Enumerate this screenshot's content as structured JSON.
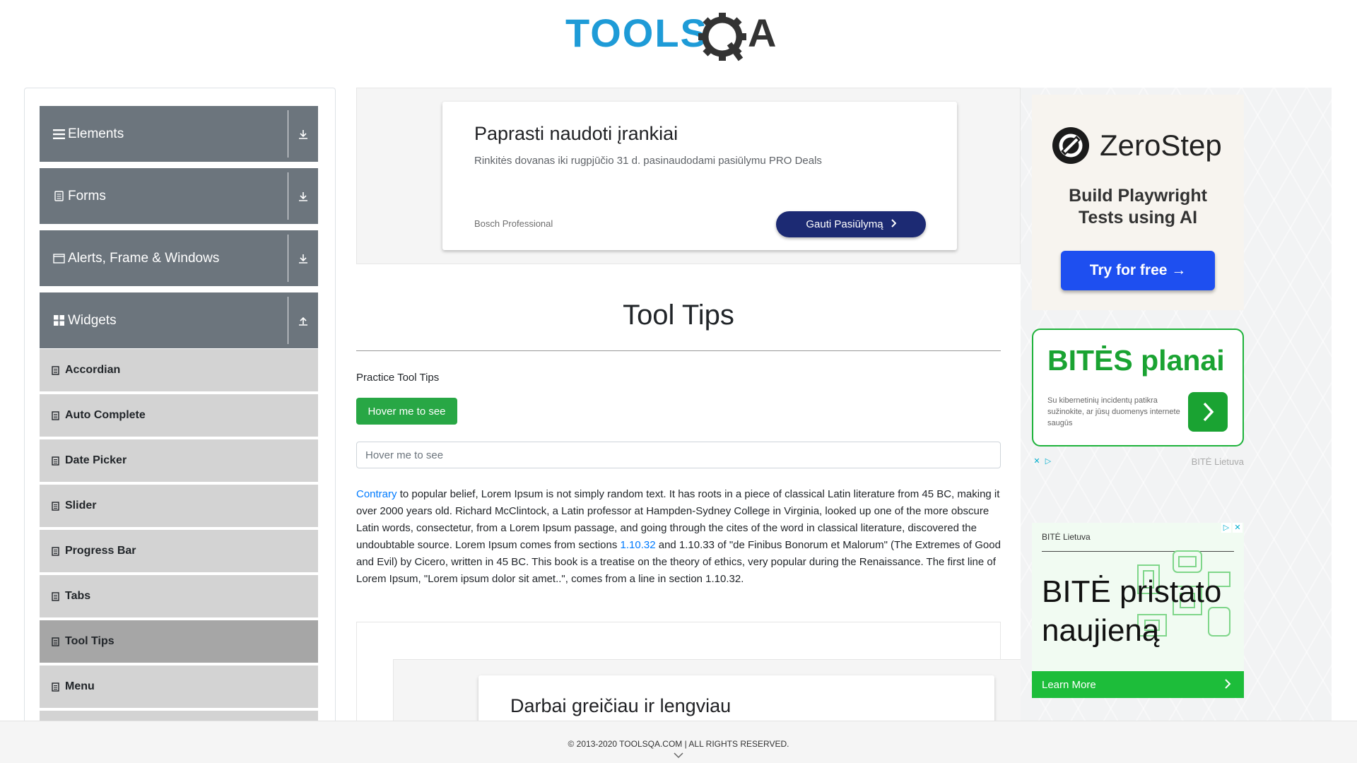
{
  "header": {
    "logo_text_blue": "TOOLS",
    "logo_text_dark": "QA"
  },
  "sidebar": {
    "groups": [
      {
        "title": "Elements",
        "icon": "hamburger-icon",
        "arrow": "download-arrow-icon"
      },
      {
        "title": "Forms",
        "icon": "form-list-icon",
        "arrow": "download-arrow-icon"
      },
      {
        "title": "Alerts, Frame & Windows",
        "icon": "window-icon",
        "arrow": "download-arrow-icon"
      },
      {
        "title": "Widgets",
        "icon": "grid-icon",
        "arrow": "upload-arrow-icon"
      }
    ],
    "items": [
      {
        "label": "Accordian"
      },
      {
        "label": "Auto Complete"
      },
      {
        "label": "Date Picker"
      },
      {
        "label": "Slider"
      },
      {
        "label": "Progress Bar"
      },
      {
        "label": "Tabs"
      },
      {
        "label": "Tool Tips"
      },
      {
        "label": "Menu"
      }
    ],
    "active_item": "Tool Tips"
  },
  "ad_top": {
    "title": "Paprasti naudoti įrankiai",
    "description": "Rinkitės dovanas iki rugpjūčio 31 d. pasinaudodami pasiūlymu PRO Deals",
    "brand": "Bosch Professional",
    "button": "Gauti Pasiūlymą"
  },
  "main": {
    "title": "Tool Tips",
    "practice_label": "Practice Tool Tips",
    "hover_button": "Hover me to see",
    "hover_input_placeholder": "Hover me to see",
    "paragraph": {
      "link1": "Contrary",
      "text1": " to popular belief, Lorem Ipsum is not simply random text. It has roots in a piece of classical Latin literature from 45 BC, making it over 2000 years old. Richard McClintock, a Latin professor at Hampden-Sydney College in Virginia, looked up one of the more obscure Latin words, consectetur, from a Lorem Ipsum passage, and going through the cites of the word in classical literature, discovered the undoubtable source. Lorem Ipsum comes from sections ",
      "link2": "1.10.32",
      "text2": " and 1.10.33 of \"de Finibus Bonorum et Malorum\" (The Extremes of Good and Evil) by Cicero, written in 45 BC. This book is a treatise on the theory of ethics, very popular during the Renaissance. The first line of Lorem Ipsum, \"Lorem ipsum dolor sit amet..\", comes from a line in section 1.10.32."
    }
  },
  "ad_bottom": {
    "title": "Darbai greičiau ir lengviau"
  },
  "right_ads": {
    "zerostep": {
      "name": "ZeroStep",
      "tagline_line1": "Build Playwright",
      "tagline_line2": "Tests using AI",
      "button": "Try for free →"
    },
    "bites_planai": {
      "title": "BITĖS planai",
      "description": "Su kibernetinių incidentų patikra sužinokite, ar jūsų duomenys internete saugūs",
      "brand": "BITĖ Lietuva"
    },
    "bites_news": {
      "brand": "BITĖ Lietuva",
      "title_line1": "BITĖ pristato",
      "title_line2": "naujieną",
      "cta": "Learn More"
    }
  },
  "footer": {
    "text": "© 2013-2020 TOOLSQA.COM | ALL RIGHTS RESERVED."
  },
  "colors": {
    "sidebar_group": "#6c757d",
    "sidebar_item": "#d3d3d3",
    "sidebar_item_active": "#a6a6a6",
    "primary_green": "#28a745",
    "link_blue": "#007bff",
    "logo_blue": "#1e9bd7",
    "logo_dark": "#333333"
  }
}
